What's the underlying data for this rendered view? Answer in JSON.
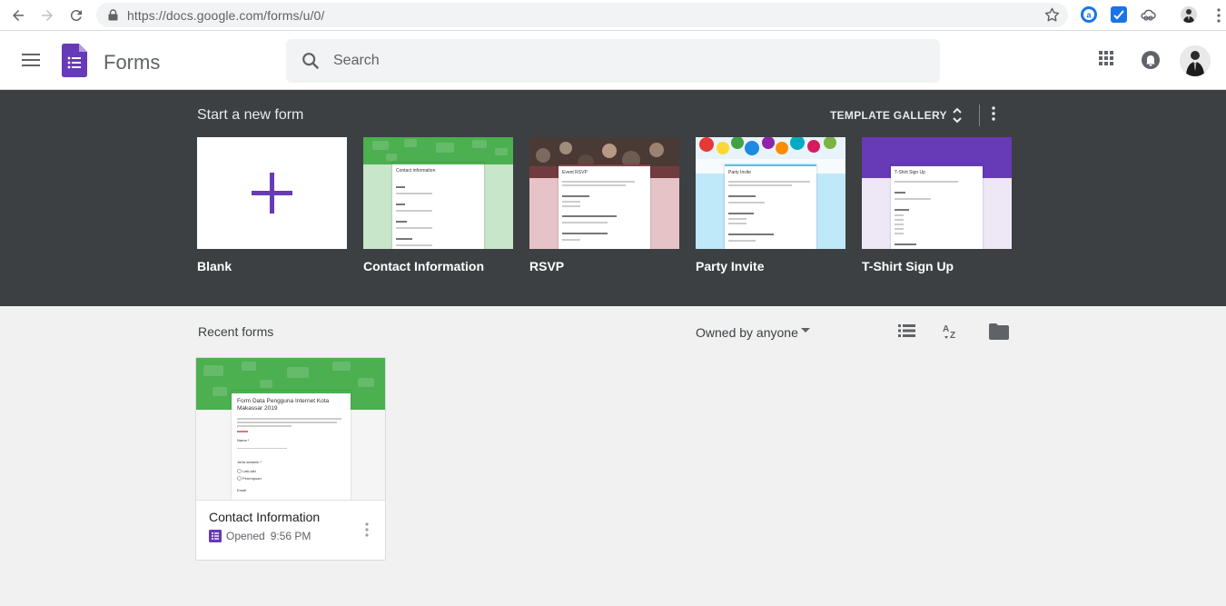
{
  "browser": {
    "url": "https://docs.google.com/forms/u/0/"
  },
  "app": {
    "title": "Forms",
    "search_placeholder": "Search"
  },
  "templates": {
    "section_title": "Start a new form",
    "gallery_label": "TEMPLATE GALLERY",
    "items": [
      {
        "label": "Blank"
      },
      {
        "label": "Contact Information",
        "preview_title": "Contact information",
        "color": "#4caf50",
        "bg": "#c8e6c9"
      },
      {
        "label": "RSVP",
        "preview_title": "Event RSVP",
        "color": "#8d3e46",
        "bg": "#e6c3c6"
      },
      {
        "label": "Party Invite",
        "preview_title": "Party Invite",
        "color": "#4fc3f7",
        "bg": "#bfe8f8"
      },
      {
        "label": "T-Shirt Sign Up",
        "preview_title": "T-Shirt Sign Up",
        "color": "#673ab7",
        "bg": "#ede7f6"
      }
    ]
  },
  "recent": {
    "section_title": "Recent forms",
    "owner_filter": "Owned by anyone",
    "docs": [
      {
        "name": "Contact Information",
        "opened_label": "Opened",
        "time": "9:56 PM",
        "preview_title": "Form Data Pengguna Internet Kota Makassar 2019",
        "preview_fields": [
          "Nama *",
          "Jenis kelamin *",
          "Laki-laki",
          "Perempuan",
          "Email"
        ]
      }
    ]
  },
  "colors": {
    "forms_purple": "#673ab7",
    "band_dark": "#3c4043",
    "contact_green": "#4caf50"
  }
}
